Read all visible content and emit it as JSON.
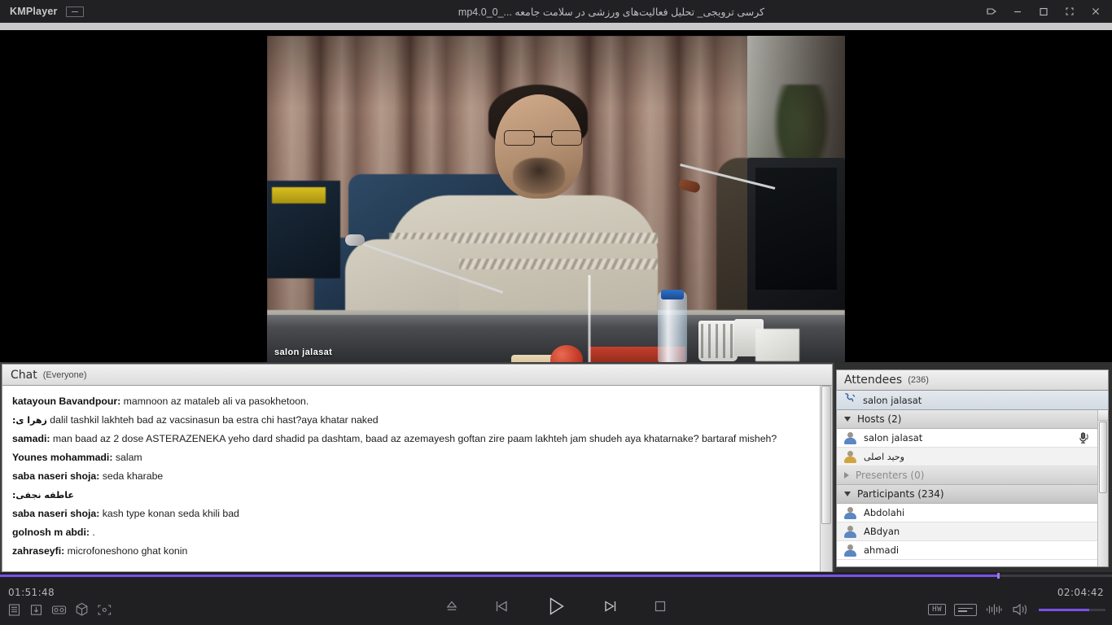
{
  "window": {
    "app_name": "KMPlayer",
    "title": "کرسی ترویجی_ تحلیل فعالیت‌های ورزشی در سلامت جامعه ..._0_0.mp4",
    "controls": {
      "cast_icon": "cast-icon",
      "minimize_icon": "minimize-icon",
      "maximize_icon": "maximize-icon",
      "fullscreen_icon": "fullscreen-icon",
      "close_icon": "close-icon"
    }
  },
  "video": {
    "watermark": "salon jalasat"
  },
  "chat": {
    "header_title": "Chat",
    "header_scope": "(Everyone)",
    "messages": [
      {
        "sender": "katayoun Bavandpour:",
        "text": "mamnoon az mataleb ali va pasokhetoon.",
        "rtl_sender": false
      },
      {
        "sender": "زهرا ی:",
        "text": "dalil tashkil lakhteh bad az vacsinasun ba estra chi hast?aya khatar naked",
        "rtl_sender": true
      },
      {
        "sender": "samadi:",
        "text": "man baad az 2 dose ASTERAZENEKA yeho dard shadid pa dashtam, baad az azemayesh goftan zire paam lakhteh jam shudeh aya khatarnake? bartaraf misheh?",
        "rtl_sender": false
      },
      {
        "sender": "Younes mohammadi:",
        "text": "salam",
        "rtl_sender": false
      },
      {
        "sender": "saba naseri shoja:",
        "text": "seda kharabe",
        "rtl_sender": false
      },
      {
        "sender": "عاطفه نجفی:",
        "text": "",
        "rtl_sender": true
      },
      {
        "sender": "saba naseri shoja:",
        "text": "kash type konan seda khili bad",
        "rtl_sender": false
      },
      {
        "sender": "golnosh m abdi:",
        "text": ".",
        "rtl_sender": false
      },
      {
        "sender": "zahraseyfi:",
        "text": "microfoneshono ghat konin",
        "rtl_sender": false
      }
    ]
  },
  "attendees": {
    "header_title": "Attendees",
    "header_count": "(236)",
    "phone_row": {
      "name": "salon jalasat",
      "icon": "phone-icon"
    },
    "groups": [
      {
        "label": "Hosts (2)",
        "expanded": true,
        "selected": false,
        "members": [
          {
            "name": "salon jalasat",
            "rtl": false,
            "avatar": "avatar-blue",
            "status_icon": "microphone-active-icon"
          },
          {
            "name": "وحید اصلی",
            "rtl": true,
            "avatar": "avatar-gold",
            "status_icon": ""
          }
        ]
      },
      {
        "label": "Presenters (0)",
        "expanded": false,
        "selected": false,
        "members": []
      },
      {
        "label": "Participants (234)",
        "expanded": true,
        "selected": true,
        "members": [
          {
            "name": "Abdolahi",
            "rtl": false,
            "avatar": "avatar-blue",
            "status_icon": ""
          },
          {
            "name": "ABdyan",
            "rtl": false,
            "avatar": "avatar-blue",
            "status_icon": ""
          },
          {
            "name": "ahmadi",
            "rtl": false,
            "avatar": "avatar-blue",
            "status_icon": ""
          }
        ]
      }
    ]
  },
  "player": {
    "current_time": "01:51:48",
    "total_time": "02:04:42",
    "progress_percent": 89.7,
    "volume_percent": 75,
    "accent_color": "#7b51e8",
    "left_tools": [
      {
        "icon": "playlist-icon",
        "label": "Playlist"
      },
      {
        "icon": "download-icon",
        "label": "Download"
      },
      {
        "icon": "vr-icon",
        "label": "VR"
      },
      {
        "icon": "3d-icon",
        "label": "3D"
      },
      {
        "icon": "screenshot-icon",
        "label": "Capture"
      }
    ],
    "center_tools": [
      {
        "icon": "eject-icon",
        "label": "Open"
      },
      {
        "icon": "previous-icon",
        "label": "Previous"
      },
      {
        "icon": "play-icon",
        "label": "Play"
      },
      {
        "icon": "next-icon",
        "label": "Next"
      },
      {
        "icon": "stop-icon",
        "label": "Stop"
      }
    ],
    "right_tools": [
      {
        "icon": "hardware-accel-icon",
        "label": "HW"
      },
      {
        "icon": "subtitle-icon",
        "label": "Subtitle"
      },
      {
        "icon": "equalizer-icon",
        "label": "Equalizer"
      },
      {
        "icon": "volume-icon",
        "label": "Volume"
      }
    ]
  }
}
